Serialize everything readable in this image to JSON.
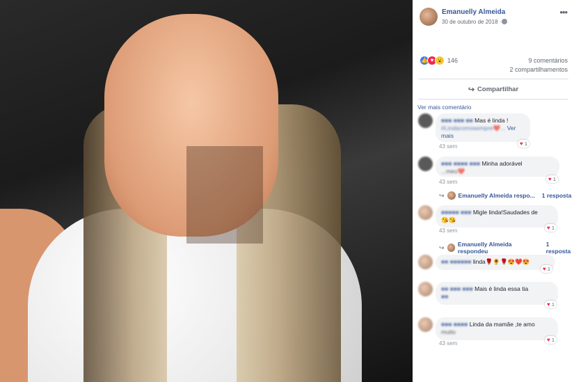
{
  "post": {
    "author": "Emanuelly Almeida",
    "date": "30 de outubro de 2018 ·",
    "reaction_count": "146",
    "comments_count": "9 comentários",
    "shares_count": "2 compartilhamentos",
    "share_label": "Compartilhar",
    "view_more_comments": "Ver mais comentário"
  },
  "comments": [
    {
      "text": "Mas é linda !",
      "line2": "#Lindacomosempre❤️...",
      "see_more": "Ver mais",
      "time": "43 sem",
      "reactions": "1"
    },
    {
      "text": "Minha adorável",
      "line2": "...meu❤️",
      "time": "43 sem",
      "reactions": "1"
    },
    {
      "text": "Migle linda!Saudades de",
      "line2": "😘😘",
      "time": "43 sem",
      "reactions": "1"
    },
    {
      "text": "linda🌹🌻🌹😍❤️😍",
      "time": "",
      "reactions": "1"
    },
    {
      "text": "Mais é linda essa tia",
      "line2": "",
      "time": "",
      "reactions": "1"
    },
    {
      "text": "Linda da mamãe ,te amo",
      "line2": "muito",
      "time": "43 sem",
      "reactions": "1"
    }
  ],
  "replies": [
    {
      "name": "Emanuelly Almeida respo...",
      "count": "1 resposta"
    },
    {
      "name": "Emanuelly Almeida respondeu",
      "count": "1 resposta"
    }
  ],
  "icons": {
    "more": "more-dots-icon",
    "globe": "globe-icon",
    "share": "share-icon",
    "heart": "heart-icon"
  },
  "colors": {
    "link": "#365899",
    "like": "#3b7ff5",
    "love": "#f0284a"
  }
}
